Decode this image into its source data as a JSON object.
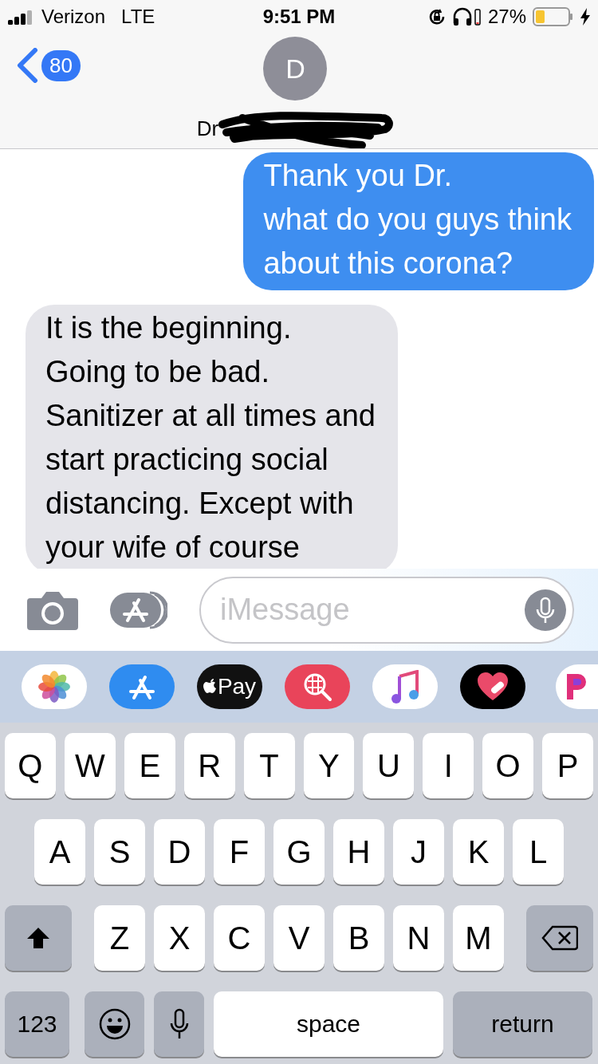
{
  "status_bar": {
    "carrier": "Verizon",
    "network": "LTE",
    "time": "9:51 PM",
    "battery_text": "27%",
    "charging": true
  },
  "header": {
    "back_count": "80",
    "avatar_initial": "D",
    "name": "Dr"
  },
  "messages": [
    {
      "kind": "sent",
      "text": "Thank you Dr.\nwhat do you guys think\nabout this corona?"
    },
    {
      "kind": "received",
      "text": "It is the beginning.\nGoing to be bad.\nSanitizer at all times and\nstart practicing social\ndistancing. Except with\nyour wife of course"
    }
  ],
  "input": {
    "placeholder": "iMessage"
  },
  "apps": [
    {
      "kind": "photos"
    },
    {
      "kind": "appstore"
    },
    {
      "kind": "applepay",
      "label": "Pay"
    },
    {
      "kind": "search"
    },
    {
      "kind": "music"
    },
    {
      "kind": "heart"
    },
    {
      "kind": "partial"
    }
  ],
  "keyboard": {
    "rows": [
      [
        "Q",
        "W",
        "E",
        "R",
        "T",
        "Y",
        "U",
        "I",
        "O",
        "P"
      ],
      [
        "A",
        "S",
        "D",
        "F",
        "G",
        "H",
        "J",
        "K",
        "L"
      ],
      [
        "Z",
        "X",
        "C",
        "V",
        "B",
        "N",
        "M"
      ]
    ],
    "numbers_key": "123",
    "space_key": "space",
    "return_key": "return"
  }
}
